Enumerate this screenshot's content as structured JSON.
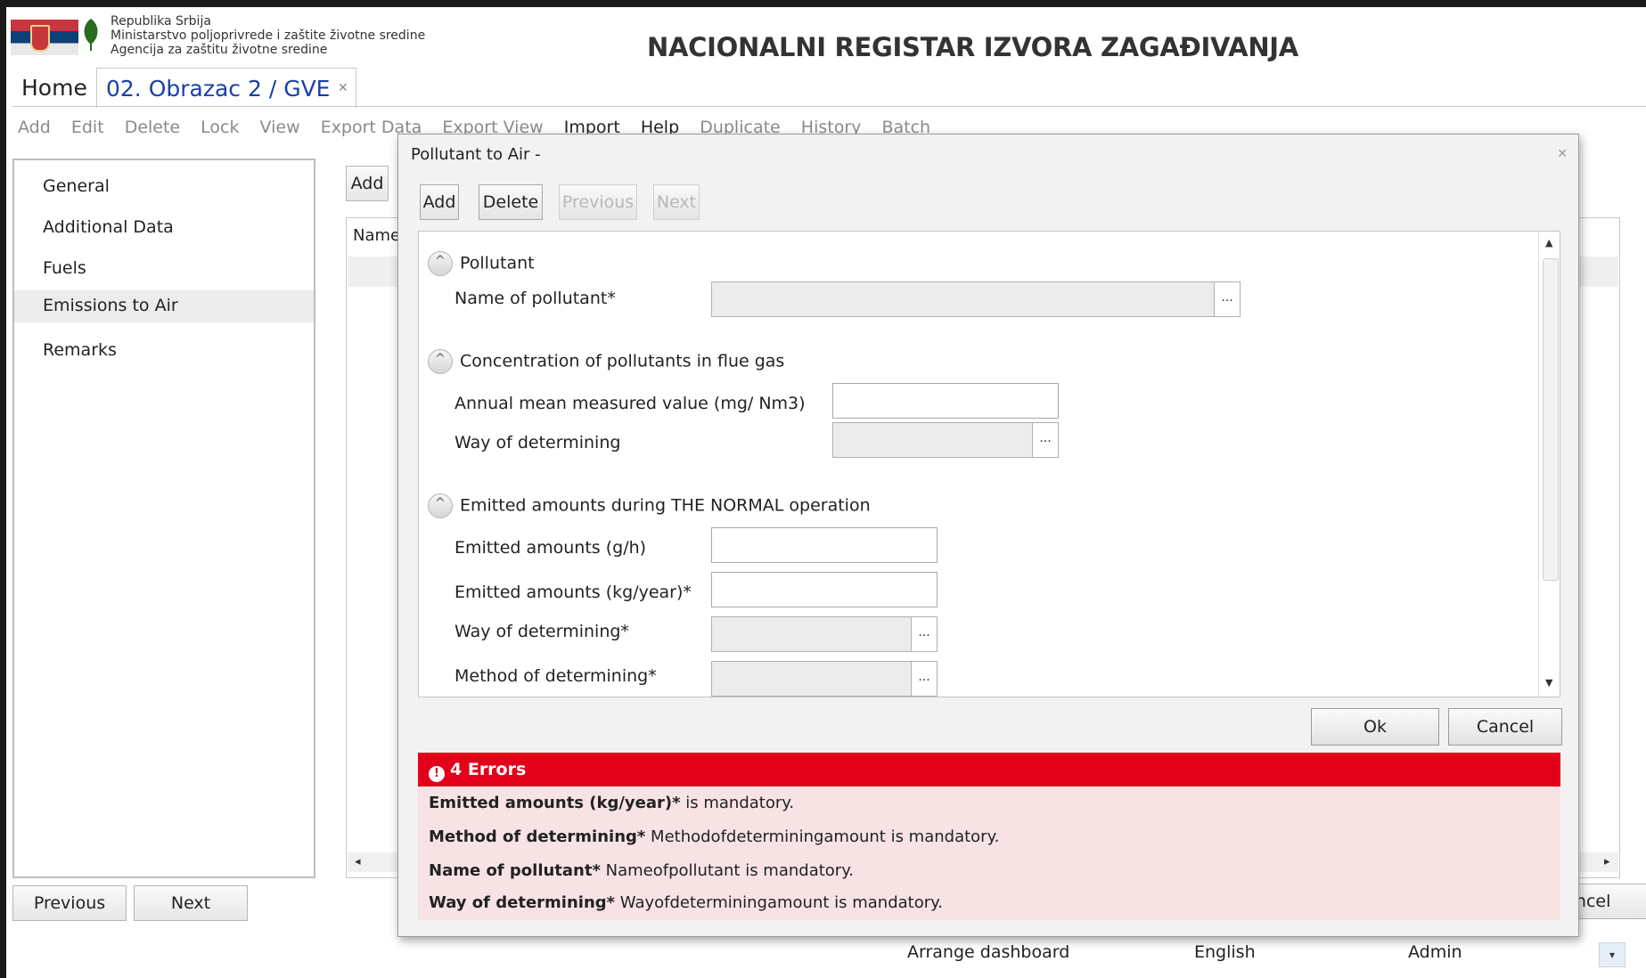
{
  "header": {
    "agency_lines": [
      "Republika Srbija",
      "Ministarstvo poljoprivrede i zaštite životne sredine",
      "Agencija za zaštitu životne sredine"
    ],
    "app_title": "NACIONALNI REGISTAR IZVORA ZAGAĐIVANJA"
  },
  "tabs": {
    "home": "Home",
    "active": "02. Obrazac 2 / GVE",
    "close": "✕"
  },
  "toolbar": [
    "Add",
    "Edit",
    "Delete",
    "Lock",
    "View",
    "Export Data",
    "Export View",
    "Import",
    "Help",
    "Duplicate",
    "History",
    "Batch"
  ],
  "nav": [
    "General",
    "Additional Data",
    "Fuels",
    "Emissions to Air",
    "Remarks"
  ],
  "nav_selected": "Emissions to Air",
  "footer_buttons": {
    "previous": "Previous",
    "next": "Next"
  },
  "background": {
    "add": "Add",
    "name_col": "Name",
    "cancel": "Cancel"
  },
  "status_bar": {
    "arrange": "Arrange dashboard",
    "language": "English",
    "user": "Admin"
  },
  "dialog": {
    "title": "Pollutant to Air -",
    "close": "✕",
    "toolbar": {
      "add": "Add",
      "delete": "Delete",
      "previous": "Previous",
      "next": "Next"
    },
    "sections": {
      "pollutant": "Pollutant",
      "concentration": "Concentration of pollutants in flue gas",
      "emitted": "Emitted amounts during THE NORMAL operation"
    },
    "fields": {
      "name_of_pollutant": "Name of pollutant*",
      "annual_mean": "Annual mean measured value (mg/ Nm3)",
      "way_of_determining_1": "Way of determining",
      "emitted_gh": "Emitted amounts (g/h)",
      "emitted_kgyear": "Emitted amounts (kg/year)*",
      "way_of_determining_2": "Way of determining*",
      "method_of_determining": "Method of determining*"
    },
    "lookup_button": "...",
    "ok": "Ok",
    "cancel": "Cancel",
    "errors": {
      "header": "4 Errors",
      "items": [
        {
          "field": "Emitted amounts (kg/year)*",
          "message": " is mandatory."
        },
        {
          "field": "Method of determining*",
          "message": " Methodofdeterminingamount is mandatory."
        },
        {
          "field": "Name of pollutant*",
          "message": " Nameofpollutant is mandatory."
        },
        {
          "field": "Way of determining*",
          "message": " Wayofdeterminingamount is mandatory."
        }
      ]
    }
  },
  "colors": {
    "error_red": "#e2001a",
    "error_bg": "#f7e3e3",
    "tab_blue": "#1a3fa8",
    "selected_nav": "#ececec"
  }
}
